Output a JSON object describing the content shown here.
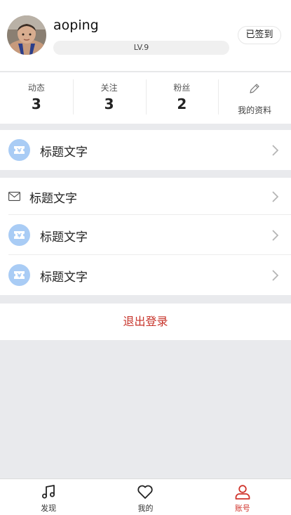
{
  "profile": {
    "username": "aoping",
    "level": "LV.9",
    "checkin_label": "已签到"
  },
  "stats": [
    {
      "label": "动态",
      "value": "3"
    },
    {
      "label": "关注",
      "value": "3"
    },
    {
      "label": "粉丝",
      "value": "2"
    }
  ],
  "edit_profile_label": "我的资料",
  "menu_group_1": [
    {
      "icon": "ticket-icon",
      "label": "标题文字"
    }
  ],
  "menu_group_2": [
    {
      "icon": "mail-icon",
      "label": "标题文字"
    },
    {
      "icon": "ticket-icon",
      "label": "标题文字"
    },
    {
      "icon": "ticket-icon",
      "label": "标题文字"
    }
  ],
  "logout_label": "退出登录",
  "tabbar": [
    {
      "icon": "music-note-icon",
      "label": "发现",
      "active": false
    },
    {
      "icon": "heart-icon",
      "label": "我的",
      "active": false
    },
    {
      "icon": "person-icon",
      "label": "账号",
      "active": true
    }
  ],
  "colors": {
    "accent": "#d0342c",
    "ticket_icon_bg": "#a9ccf5",
    "page_bg": "#e9eaed"
  }
}
